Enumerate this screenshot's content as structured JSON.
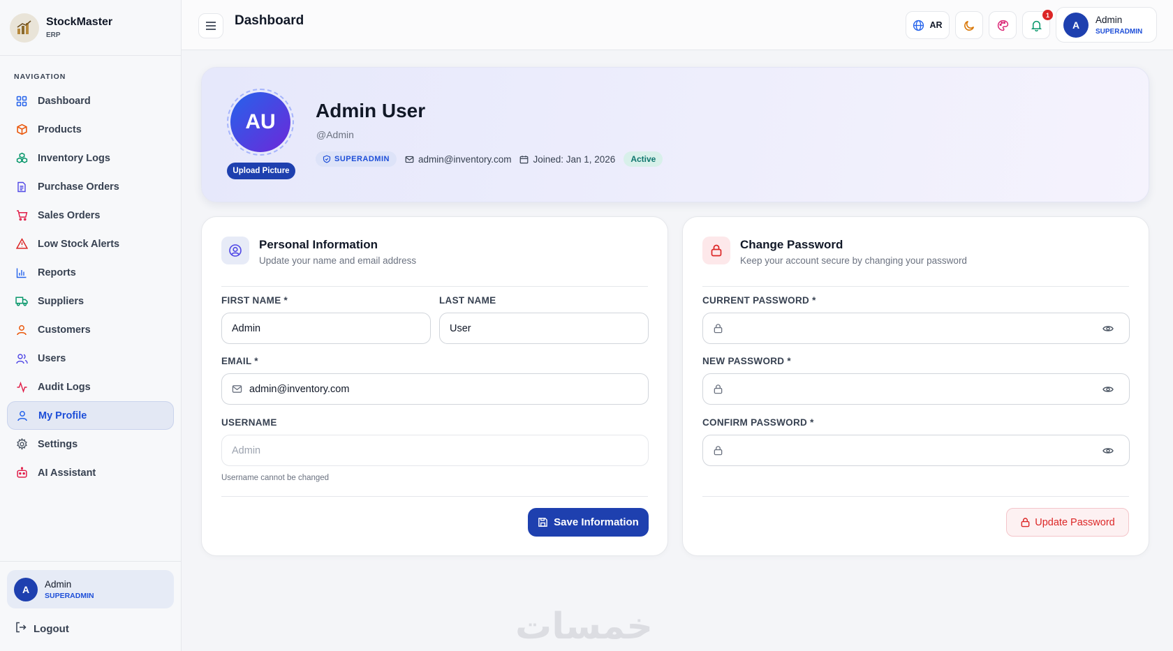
{
  "brand": {
    "name": "StockMaster",
    "sub": "ERP"
  },
  "sidebar": {
    "heading": "NAVIGATION",
    "items": [
      {
        "label": "Dashboard",
        "icon": "grid-icon",
        "color": "#2563eb"
      },
      {
        "label": "Products",
        "icon": "package-icon",
        "color": "#ea580c"
      },
      {
        "label": "Inventory Logs",
        "icon": "boxes-icon",
        "color": "#059669"
      },
      {
        "label": "Purchase Orders",
        "icon": "document-icon",
        "color": "#4f46e5"
      },
      {
        "label": "Sales Orders",
        "icon": "cart-icon",
        "color": "#e11d48"
      },
      {
        "label": "Low Stock Alerts",
        "icon": "alert-triangle-icon",
        "color": "#dc2626"
      },
      {
        "label": "Reports",
        "icon": "bar-chart-icon",
        "color": "#2563eb"
      },
      {
        "label": "Suppliers",
        "icon": "truck-icon",
        "color": "#059669"
      },
      {
        "label": "Customers",
        "icon": "user-icon",
        "color": "#ea580c"
      },
      {
        "label": "Users",
        "icon": "users-icon",
        "color": "#4f46e5"
      },
      {
        "label": "Audit Logs",
        "icon": "activity-icon",
        "color": "#e11d48"
      },
      {
        "label": "My Profile",
        "icon": "user-icon",
        "color": "#2563eb",
        "active": true
      },
      {
        "label": "Settings",
        "icon": "gear-icon",
        "color": "#4b5563"
      },
      {
        "label": "AI Assistant",
        "icon": "bot-icon",
        "color": "#e11d48"
      }
    ],
    "user": {
      "initial": "A",
      "name": "Admin",
      "role": "SUPERADMIN"
    },
    "logout": "Logout"
  },
  "topbar": {
    "title": "Dashboard",
    "lang": "AR",
    "notification_count": "1",
    "user": {
      "initial": "A",
      "name": "Admin",
      "role": "SUPERADMIN"
    }
  },
  "profile": {
    "initials": "AU",
    "upload_label": "Upload Picture",
    "name": "Admin User",
    "handle": "@Admin",
    "role": "SUPERADMIN",
    "email": "admin@inventory.com",
    "joined": "Joined: Jan 1, 2026",
    "status": "Active"
  },
  "personal": {
    "title": "Personal Information",
    "subtitle": "Update your name and email address",
    "first_name_label": "FIRST NAME *",
    "first_name": "Admin",
    "last_name_label": "LAST NAME",
    "last_name": "User",
    "email_label": "EMAIL *",
    "email": "admin@inventory.com",
    "username_label": "USERNAME",
    "username": "Admin",
    "username_hint": "Username cannot be changed",
    "save_label": "Save Information"
  },
  "password": {
    "title": "Change Password",
    "subtitle": "Keep your account secure by changing your password",
    "current_label": "CURRENT PASSWORD *",
    "new_label": "NEW PASSWORD *",
    "confirm_label": "CONFIRM PASSWORD *",
    "update_label": "Update Password"
  },
  "watermark": "خمسات"
}
